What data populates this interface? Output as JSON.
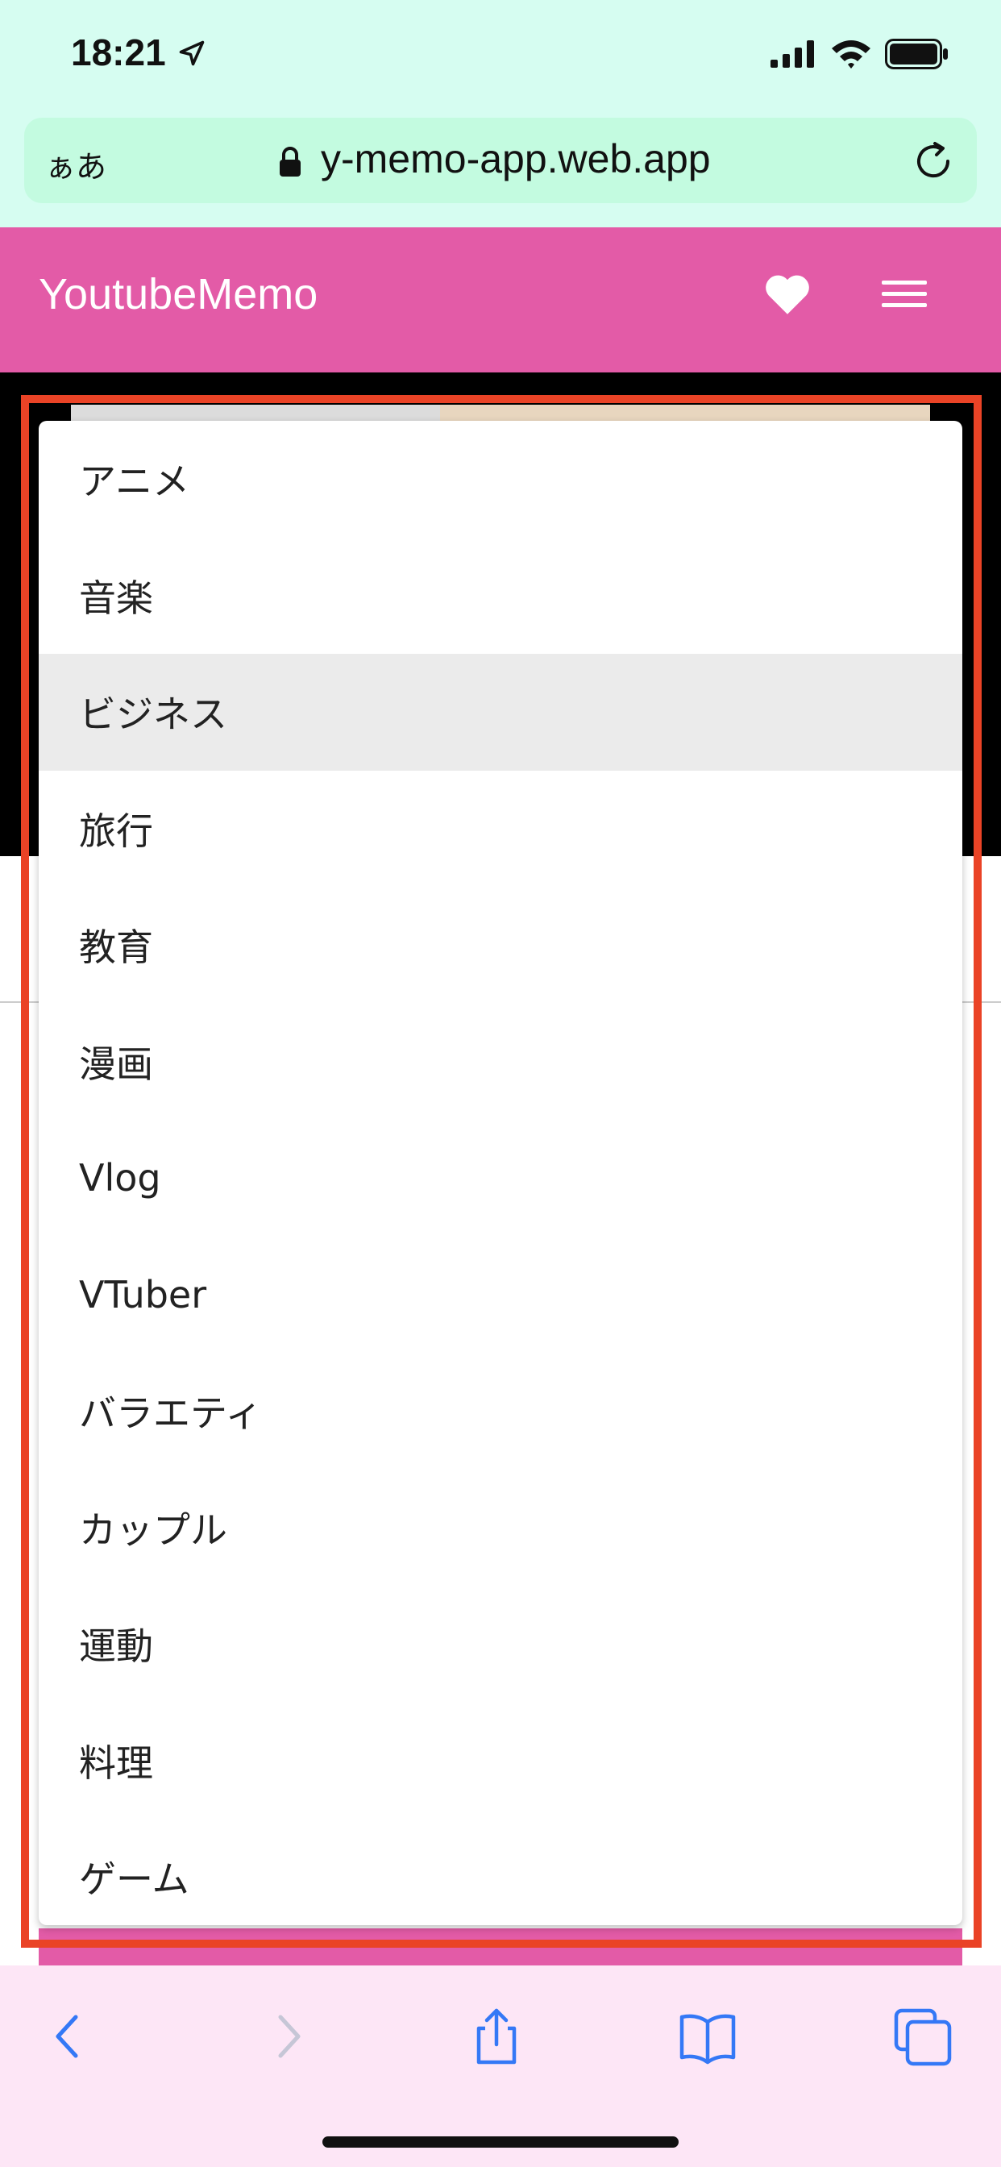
{
  "status_bar": {
    "time": "18:21",
    "icons": [
      "location-arrow-icon",
      "signal-icon",
      "wifi-icon",
      "battery-icon"
    ]
  },
  "browser": {
    "text_size_button": "ぁあ",
    "url": "y-memo-app.web.app",
    "icons": [
      "lock-icon",
      "reload-icon"
    ]
  },
  "app_header": {
    "title": "YoutubeMemo",
    "background": "#e35ba7",
    "icons": [
      "heart-icon",
      "hamburger-menu-icon"
    ]
  },
  "dropdown": {
    "items": [
      {
        "label": "アニメ"
      },
      {
        "label": "音楽"
      },
      {
        "label": "ビジネス",
        "selected": true
      },
      {
        "label": "旅行"
      },
      {
        "label": "教育"
      },
      {
        "label": "漫画"
      },
      {
        "label": "Vlog"
      },
      {
        "label": "VTuber"
      },
      {
        "label": "バラエティ"
      },
      {
        "label": "カップル"
      },
      {
        "label": "運動"
      },
      {
        "label": "料理"
      },
      {
        "label": "ゲーム"
      }
    ],
    "highlight_color": "#ea4326"
  },
  "toolbar": {
    "icons": [
      "back-icon",
      "forward-icon",
      "share-icon",
      "bookmarks-icon",
      "tabs-icon"
    ]
  }
}
